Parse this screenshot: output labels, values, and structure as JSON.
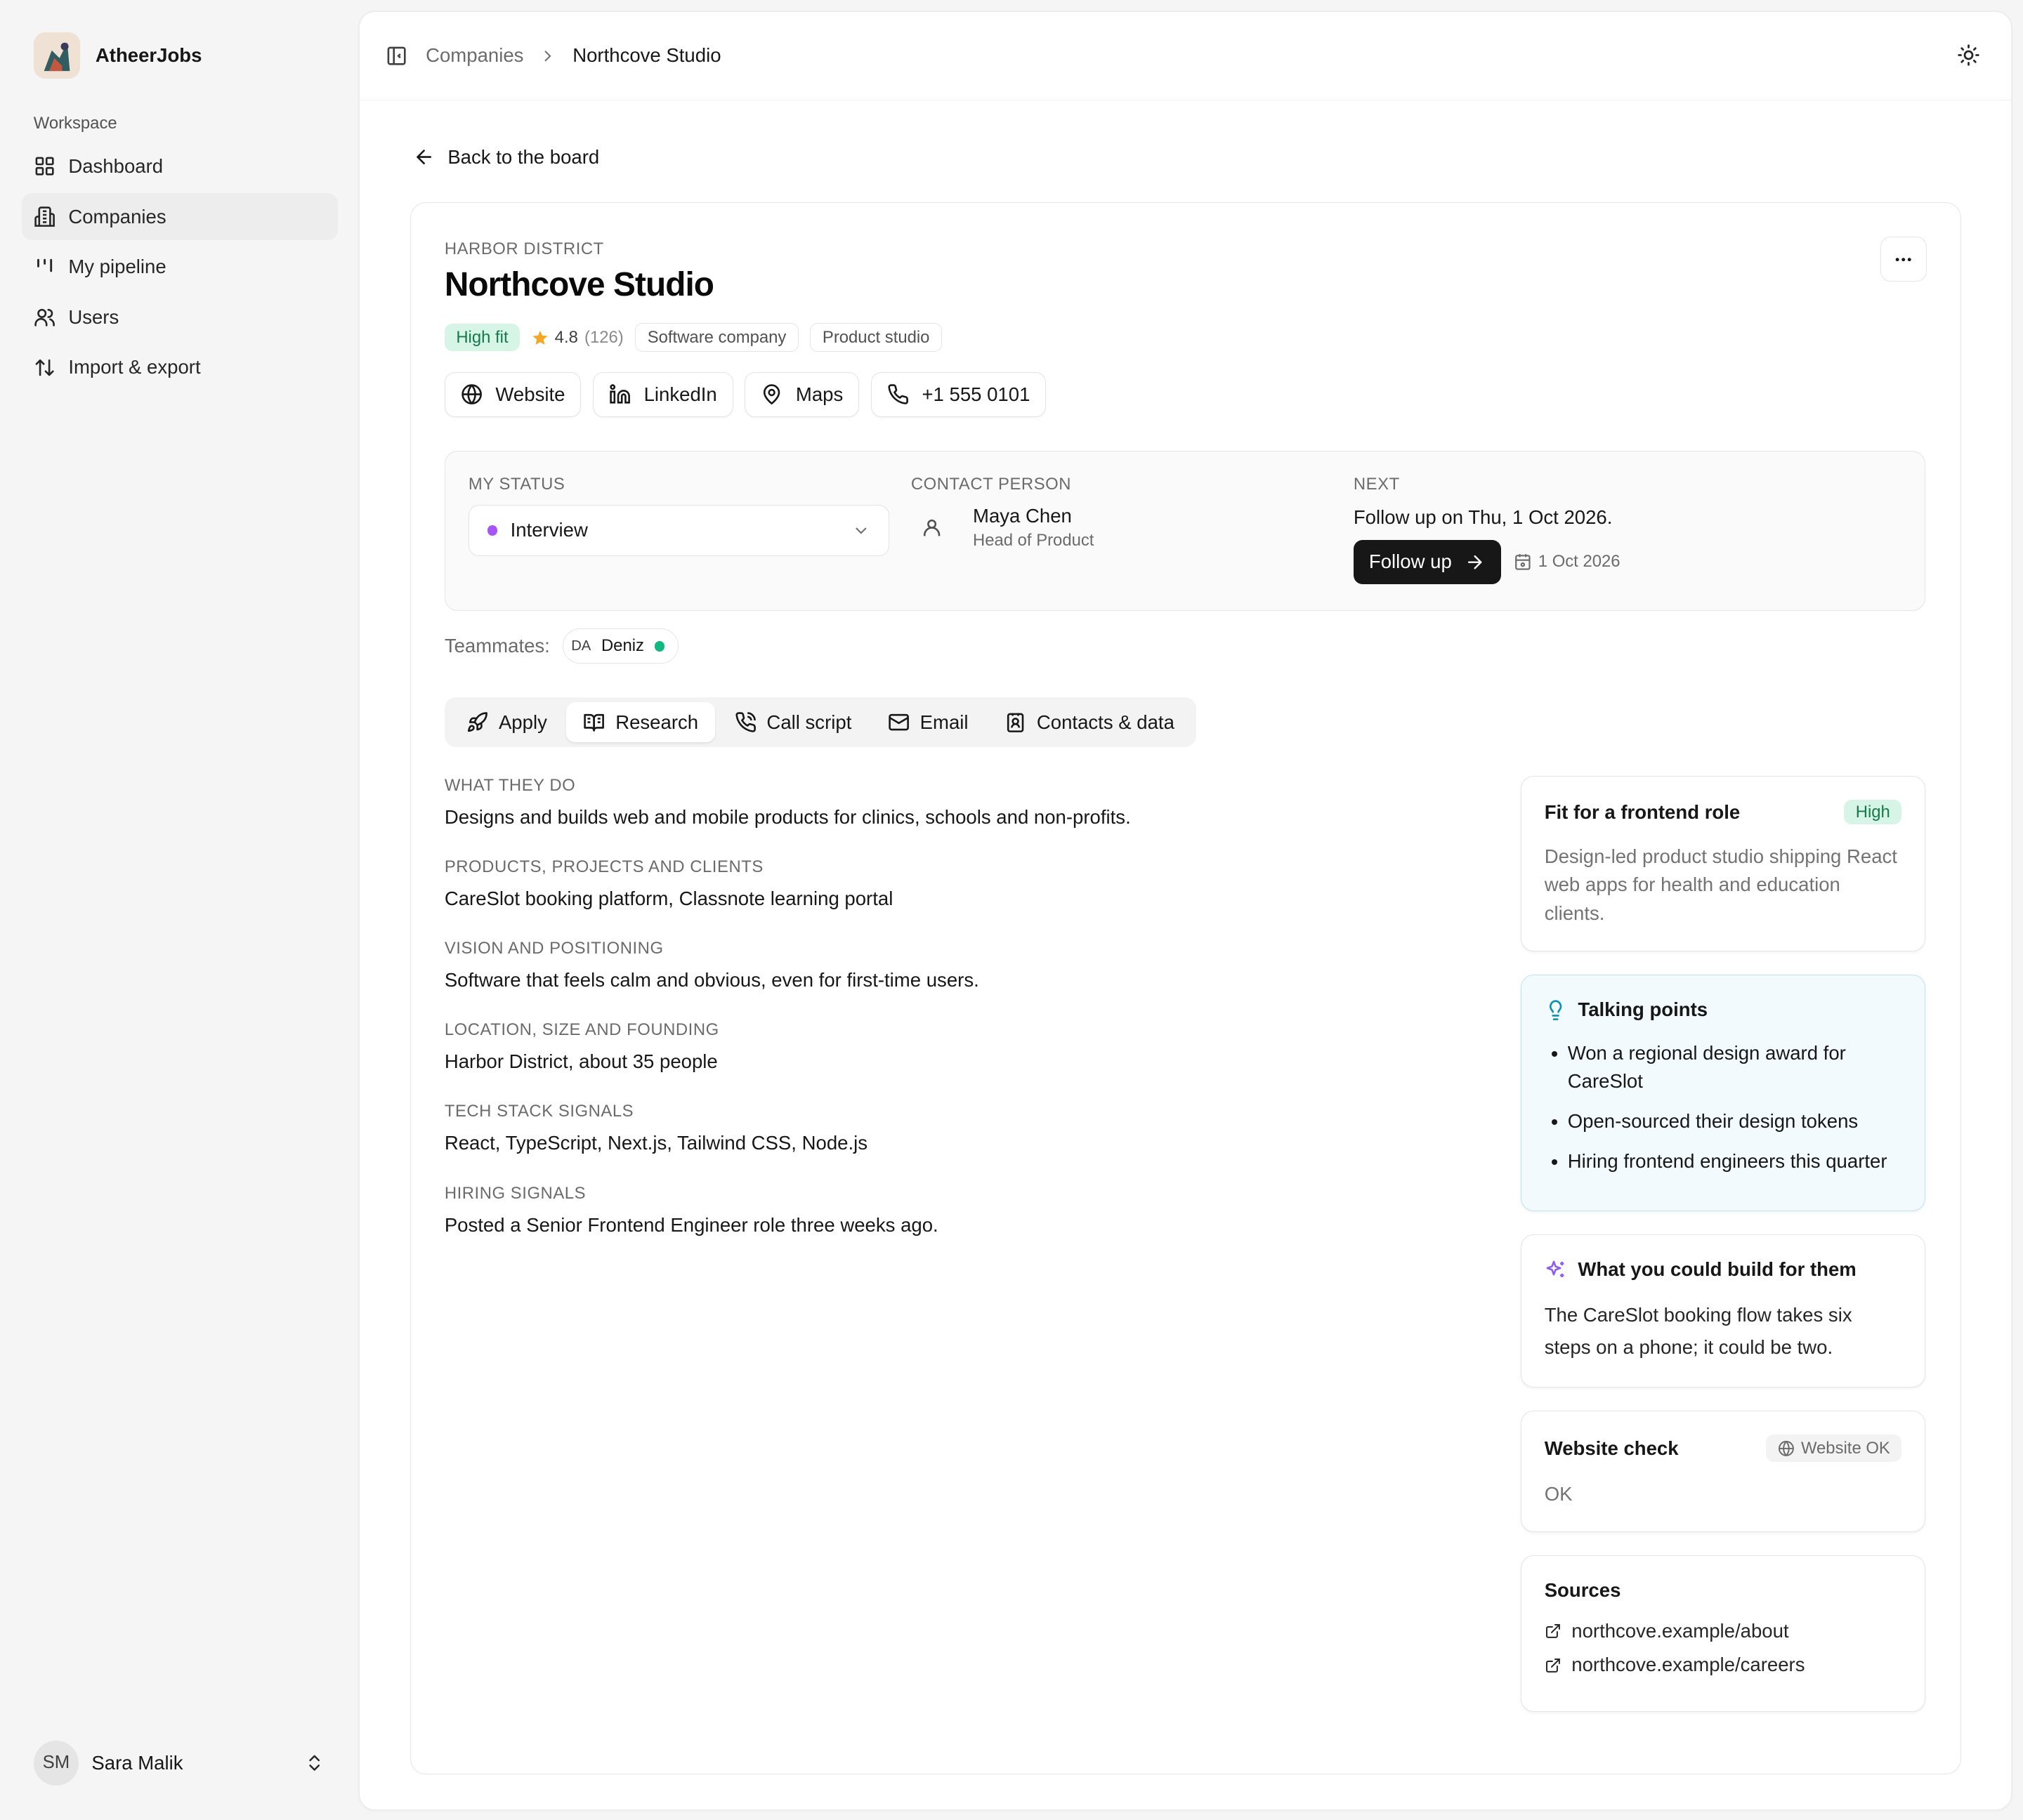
{
  "app": {
    "name": "AtheerJobs",
    "workspace_label": "Workspace"
  },
  "sidebar": {
    "items": [
      {
        "label": "Dashboard",
        "icon": "dashboard-icon"
      },
      {
        "label": "Companies",
        "icon": "building-icon",
        "active": true
      },
      {
        "label": "My pipeline",
        "icon": "pipeline-icon"
      },
      {
        "label": "Users",
        "icon": "users-icon"
      },
      {
        "label": "Import & export",
        "icon": "sort-arrows-icon"
      }
    ],
    "user": {
      "initials": "SM",
      "name": "Sara Malik"
    }
  },
  "breadcrumb": {
    "parent": "Companies",
    "current": "Northcove Studio"
  },
  "back_label": "Back to the board",
  "company": {
    "district": "HARBOR DISTRICT",
    "name": "Northcove Studio",
    "fit": "High fit",
    "rating": "4.8",
    "rating_count": "(126)",
    "tags": [
      "Software company",
      "Product studio"
    ],
    "links": {
      "website": "Website",
      "linkedin": "LinkedIn",
      "maps": "Maps",
      "phone": "+1 555 0101"
    }
  },
  "status": {
    "my_status_label": "MY STATUS",
    "my_status_value": "Interview",
    "contact_label": "CONTACT PERSON",
    "contact_name": "Maya Chen",
    "contact_role": "Head of Product",
    "next_label": "NEXT",
    "next_text": "Follow up on Thu, 1 Oct 2026.",
    "follow_button": "Follow up",
    "follow_date": "1 Oct 2026"
  },
  "teammates": {
    "label": "Teammates:",
    "items": [
      {
        "initials": "DA",
        "name": "Deniz"
      }
    ]
  },
  "tabs": [
    {
      "label": "Apply"
    },
    {
      "label": "Research",
      "active": true
    },
    {
      "label": "Call script"
    },
    {
      "label": "Email"
    },
    {
      "label": "Contacts & data"
    }
  ],
  "research": [
    {
      "label": "WHAT THEY DO",
      "text": "Designs and builds web and mobile products for clinics, schools and non-profits."
    },
    {
      "label": "PRODUCTS, PROJECTS AND CLIENTS",
      "text": "CareSlot booking platform, Classnote learning portal"
    },
    {
      "label": "VISION AND POSITIONING",
      "text": "Software that feels calm and obvious, even for first-time users."
    },
    {
      "label": "LOCATION, SIZE AND FOUNDING",
      "text": "Harbor District, about 35 people"
    },
    {
      "label": "TECH STACK SIGNALS",
      "text": "React, TypeScript, Next.js, Tailwind CSS, Node.js"
    },
    {
      "label": "HIRING SIGNALS",
      "text": "Posted a Senior Frontend Engineer role three weeks ago."
    }
  ],
  "aside": {
    "fit": {
      "title": "Fit for a frontend role",
      "badge": "High",
      "body": "Design-led product studio shipping React web apps for health and education clients."
    },
    "talking_points": {
      "title": "Talking points",
      "items": [
        "Won a regional design award for CareSlot",
        "Open-sourced their design tokens",
        "Hiring frontend engineers this quarter"
      ]
    },
    "build": {
      "title": "What you could build for them",
      "body": "The CareSlot booking flow takes six steps on a phone; it could be two."
    },
    "website_check": {
      "title": "Website check",
      "badge": "Website OK",
      "body": "OK"
    },
    "sources": {
      "title": "Sources",
      "items": [
        "northcove.example/about",
        "northcove.example/careers"
      ]
    }
  },
  "colors": {
    "status_dot": "#a855f7",
    "fit_green_bg": "#d6f5e6",
    "fit_green_text": "#157a4a",
    "live_dot": "#10b981",
    "star": "#f5a623",
    "talking_points_bg": "#f2fafd",
    "sparkle": "#8b5cf6"
  }
}
